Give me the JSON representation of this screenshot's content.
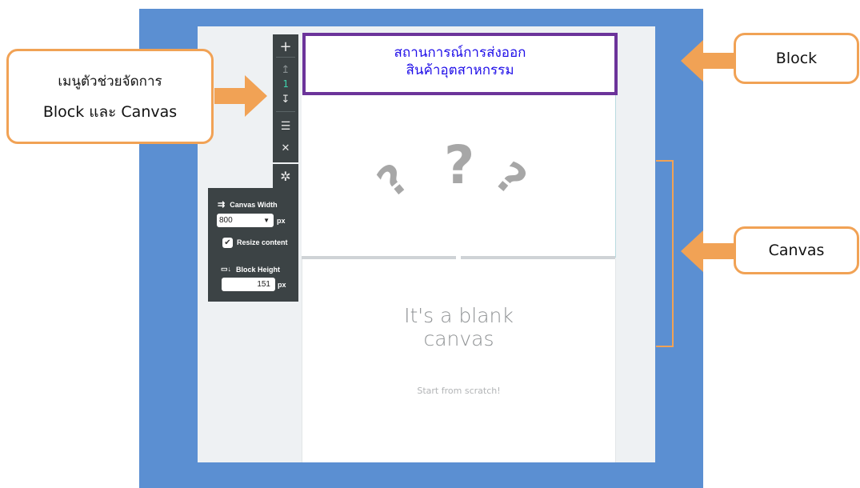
{
  "title_box": {
    "line1": "สถานการณ์การส่งออก",
    "line2": "สินค้าอุตสาหกรรม"
  },
  "toolbar": {
    "add": "+",
    "move_up": "↥",
    "index": "1",
    "move_down": "↧",
    "stack": "☰",
    "close": "✕",
    "settings": "✲"
  },
  "settings_panel": {
    "canvas_width_label": "Canvas Width",
    "canvas_width_value": "800",
    "canvas_width_unit": "px",
    "resize_label": "Resize content",
    "resize_checked": true,
    "block_height_label": "Block Height",
    "block_height_value": "151",
    "block_height_unit": "px"
  },
  "block_content": {
    "q1": "?",
    "q2": "?",
    "q3": "?"
  },
  "canvas": {
    "title_line1": "It's a blank",
    "title_line2": "canvas",
    "subtitle": "Start from scratch!"
  },
  "callouts": {
    "menu_line1": "เมนูตัวช่วยจัดการ",
    "menu_line2": "Block และ Canvas",
    "block": "Block",
    "canvas": "Canvas"
  },
  "colors": {
    "frame": "#5b8fd2",
    "callout_border": "#f1a255",
    "title_border": "#6c349a",
    "title_text": "#1f0ee8"
  }
}
